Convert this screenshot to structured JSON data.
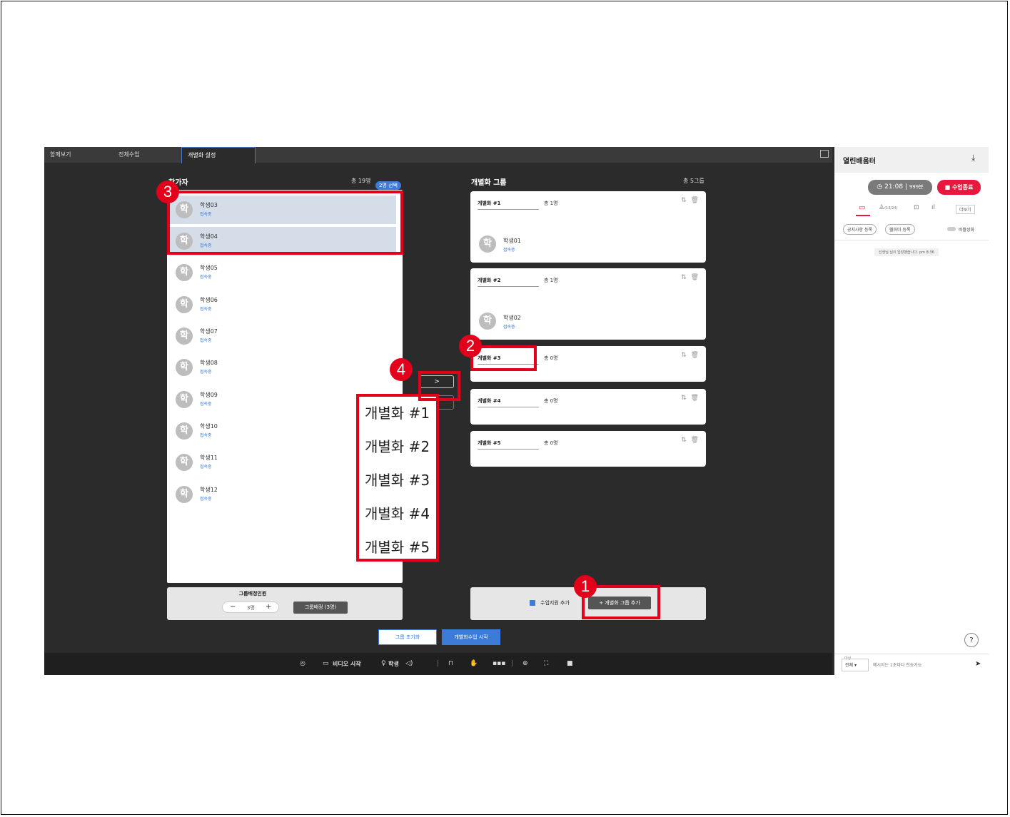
{
  "tabs": [
    "함께보기",
    "전체수업",
    "개별화 설정"
  ],
  "participants": {
    "title": "참가자",
    "total": "총 19명",
    "selected": "2명 선택",
    "students": [
      {
        "name": "학생03",
        "status": "접속중",
        "selected": true
      },
      {
        "name": "학생04",
        "status": "접속중",
        "selected": true
      },
      {
        "name": "학생05",
        "status": "접속중",
        "selected": false
      },
      {
        "name": "학생06",
        "status": "접속중",
        "selected": false
      },
      {
        "name": "학생07",
        "status": "접속중",
        "selected": false
      },
      {
        "name": "학생08",
        "status": "접속중",
        "selected": false
      },
      {
        "name": "학생09",
        "status": "접속중",
        "selected": false
      },
      {
        "name": "학생10",
        "status": "접속중",
        "selected": false
      },
      {
        "name": "학생11",
        "status": "접속중",
        "selected": false
      },
      {
        "name": "학생12",
        "status": "접속중",
        "selected": false
      }
    ],
    "avatar_char": "학",
    "assign_label": "그룹배정인원",
    "assign_value": "3명",
    "assign_button": "그룹배정 (3명)",
    "minus": "−",
    "plus": "+"
  },
  "groups": {
    "title": "개별화 그룹",
    "total": "총 5그룹",
    "items": [
      {
        "name": "개별화 #1",
        "count": "총 1명",
        "member": "학생01",
        "member_status": "접속중"
      },
      {
        "name": "개별화 #2",
        "count": "총 1명",
        "member": "학생02",
        "member_status": "접속중"
      },
      {
        "name": "개별화 #3",
        "count": "총 0명"
      },
      {
        "name": "개별화 #4",
        "count": "총 0명"
      },
      {
        "name": "개별화 #5",
        "count": "총 0명"
      }
    ],
    "assistant_label": "수업지원 추가",
    "add_group_button": "+ 개별화 그룹 추가"
  },
  "move_button": ">",
  "dropdown": [
    "개별화 #1",
    "개별화 #2",
    "개별화 #3",
    "개별화 #4",
    "개별화 #5"
  ],
  "actions": {
    "reset": "그룹 초기화",
    "start": "개별화수업 시작"
  },
  "toolbar": {
    "video": "비디오 시작",
    "mic": "학생"
  },
  "sidebar": {
    "title": "열린배움터",
    "timer": "21:08",
    "minutes": "999분",
    "end_button": "수업종료",
    "participants_count": "(13/24)",
    "more": "더보기",
    "notice_button": "공지사항 등록",
    "helper_button": "헬퍼미 등록",
    "toggle_label": "비활성화",
    "system_message": "선생님 님이 입장했습니다. pm 8:36",
    "target_label": "대상",
    "target_value": "전체",
    "message_placeholder": "메시지는 1초마다 전송가능"
  },
  "badges": [
    "1",
    "2",
    "3",
    "4"
  ],
  "colors": {
    "accent": "#3d7bd8",
    "callout": "#e3001b",
    "end": "#e8173d"
  }
}
